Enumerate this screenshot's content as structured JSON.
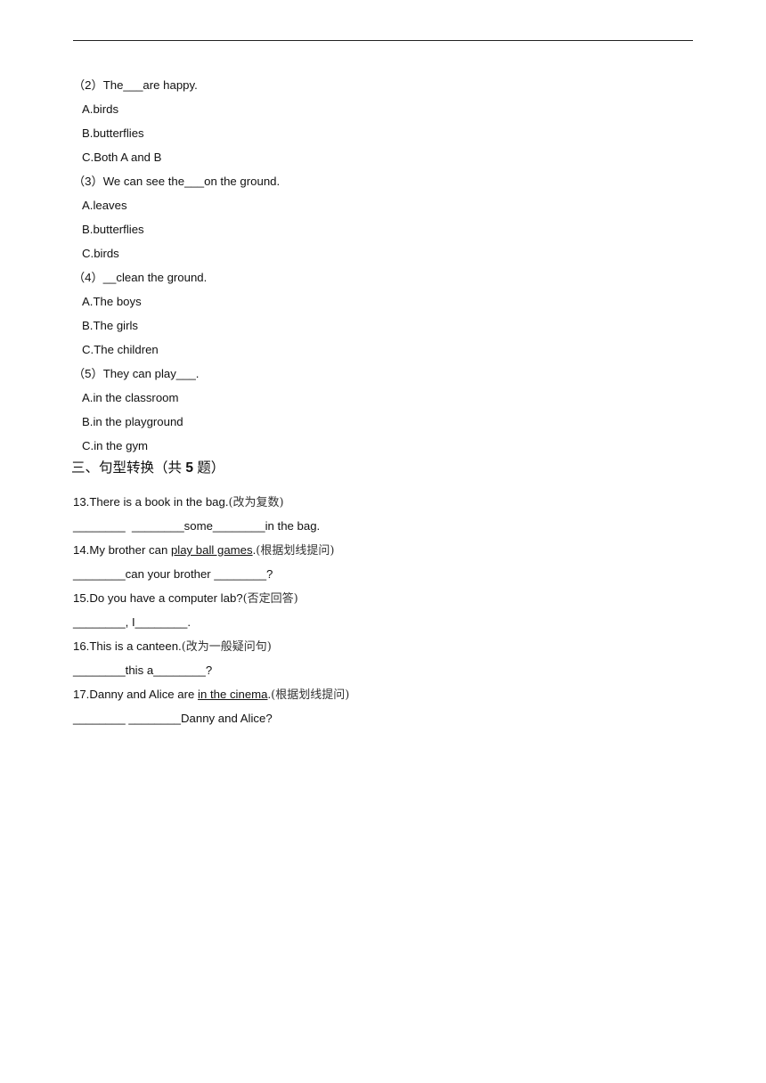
{
  "part2_questions": [
    {
      "prompt": "（2）The___are happy.",
      "options": [
        "A.birds",
        "B.butterflies",
        "C.Both A and B"
      ]
    },
    {
      "prompt": "（3）We can see the___on the ground.",
      "options": [
        "A.leaves",
        "B.butterflies",
        "C.birds"
      ]
    },
    {
      "prompt": "（4）__clean the ground.",
      "options": [
        "A.The boys",
        "B.The girls",
        "C.The children"
      ]
    },
    {
      "prompt": "（5）They can play___.",
      "options": [
        "A.in the classroom",
        "B.in the playground",
        "C.in the gym"
      ]
    }
  ],
  "section3": {
    "heading_pre": "三、句型转换（共 ",
    "heading_num": "5",
    "heading_post": " 题）",
    "items": [
      {
        "q_pre": "13.There is a book in the bag.",
        "q_underlined": "",
        "q_post": "",
        "hint": "(改为复数)",
        "answer": "________  ________some________in the bag."
      },
      {
        "q_pre": "14.My brother can ",
        "q_underlined": "play ball games",
        "q_post": ".",
        "hint": "(根据划线提问)",
        "answer": "________can your brother ________?"
      },
      {
        "q_pre": "15.Do you have a computer lab?",
        "q_underlined": "",
        "q_post": "",
        "hint": "(否定回答)",
        "answer": "________, I________."
      },
      {
        "q_pre": "16.This is a canteen.",
        "q_underlined": "",
        "q_post": "",
        "hint": "(改为一般疑问句)",
        "answer": "________this a________?"
      },
      {
        "q_pre": "17.Danny and Alice are ",
        "q_underlined": "in the cinema",
        "q_post": ".",
        "hint": "(根据划线提问)",
        "answer": "________ ________Danny and Alice?"
      }
    ]
  }
}
